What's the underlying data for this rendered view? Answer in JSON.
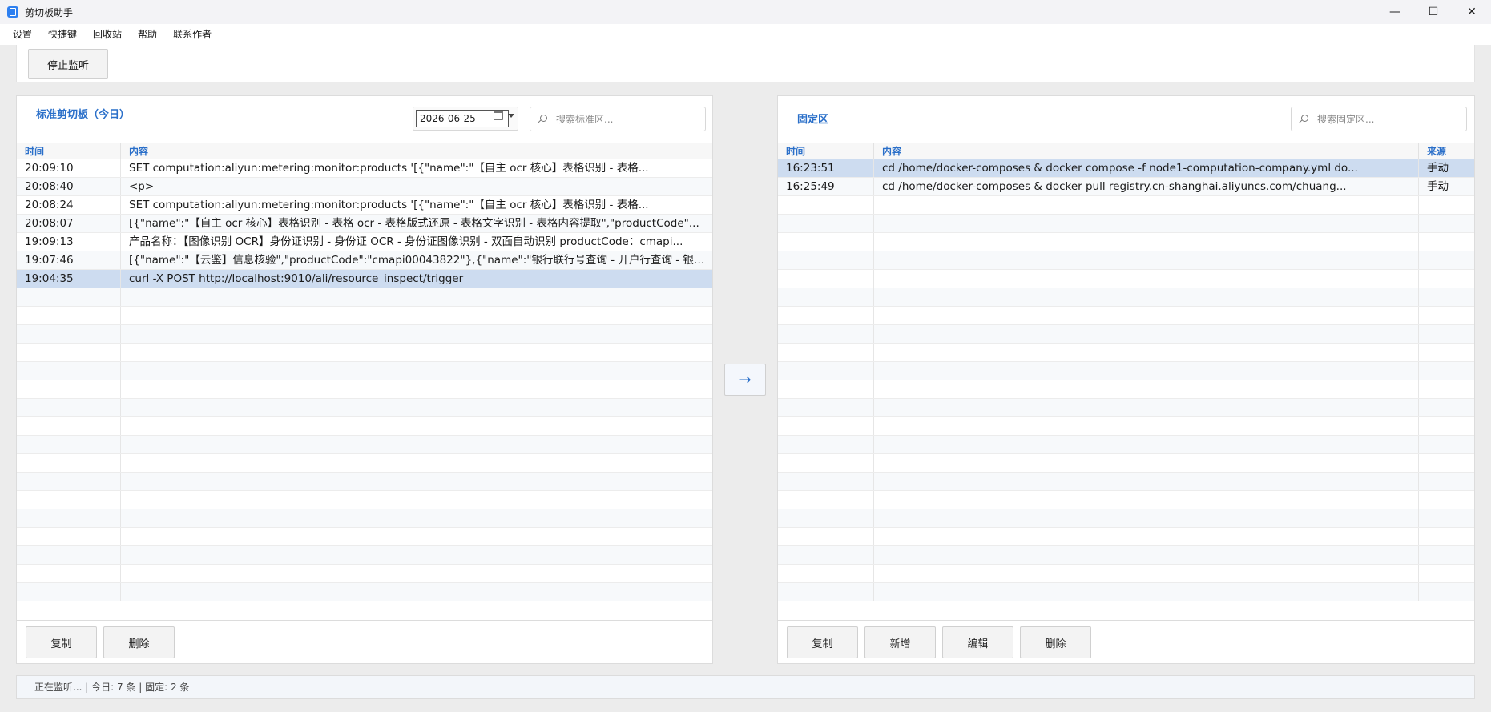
{
  "window": {
    "title": "剪切板助手"
  },
  "menu": [
    "设置",
    "快捷键",
    "回收站",
    "帮助",
    "联系作者"
  ],
  "toolbar": {
    "stop_label": "停止监听"
  },
  "left": {
    "title": "标准剪切板（今日）",
    "date": "2026-06-25",
    "search_placeholder": "搜索标准区...",
    "columns": [
      "时间",
      "内容"
    ],
    "rows": [
      {
        "time": "20:09:10",
        "content": "SET computation:aliyun:metering:monitor:products '[{\"name\":\"【自主 ocr 核心】表格识别 - 表格..."
      },
      {
        "time": "20:08:40",
        "content": "<p>"
      },
      {
        "time": "20:08:24",
        "content": "SET computation:aliyun:metering:monitor:products '[{\"name\":\"【自主 ocr 核心】表格识别 - 表格..."
      },
      {
        "time": "20:08:07",
        "content": "[{\"name\":\"【自主 ocr 核心】表格识别 - 表格 ocr - 表格版式还原 - 表格文字识别 - 表格内容提取\",\"productCode\"..."
      },
      {
        "time": "19:09:13",
        "content": "产品名称：【图像识别 OCR】身份证识别 - 身份证 OCR - 身份证图像识别 - 双面自动识别 productCode：cmapi..."
      },
      {
        "time": "19:07:46",
        "content": "[{\"name\":\"【云鉴】信息核验\",\"productCode\":\"cmapi00043822\"},{\"name\":\"银行联行号查询 - 开户行查询 - 银行..."
      },
      {
        "time": "19:04:35",
        "content": "curl -X POST http://localhost:9010/ali/resource_inspect/trigger"
      }
    ],
    "selected_index": 6,
    "buttons": {
      "copy": "复制",
      "delete": "删除"
    }
  },
  "move_button": "→",
  "right": {
    "title": "固定区",
    "search_placeholder": "搜索固定区...",
    "columns": [
      "时间",
      "内容",
      "来源"
    ],
    "rows": [
      {
        "time": "16:23:51",
        "content": "cd /home/docker-composes   & docker compose -f node1-computation-company.yml do...",
        "source": "手动"
      },
      {
        "time": "16:25:49",
        "content": "cd /home/docker-composes & docker pull registry.cn-shanghai.aliyuncs.com/chuang...",
        "source": "手动"
      }
    ],
    "selected_index": 0,
    "buttons": {
      "copy": "复制",
      "add": "新增",
      "edit": "编辑",
      "delete": "删除"
    }
  },
  "status": "正在监听... | 今日: 7 条 | 固定: 2 条",
  "colors": {
    "accent": "#2a6fc9",
    "selected_row": "#cddcf0"
  }
}
